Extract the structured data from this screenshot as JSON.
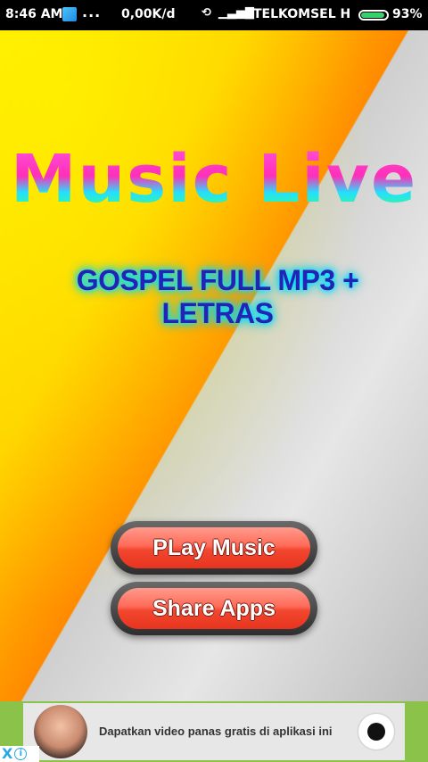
{
  "status_bar": {
    "time": "8:46 AM",
    "dots": "...",
    "speed": "0,00K/d",
    "carrier": "TELKOMSEL H",
    "battery_pct": "93%",
    "battery_level": 0.93
  },
  "main": {
    "title": "Music Live",
    "subtitle": "GOSPEL FULL MP3 + LETRAS",
    "buttons": [
      {
        "label": "PLay Music"
      },
      {
        "label": "Share Apps"
      }
    ]
  },
  "ad": {
    "text": "Dapatkan video panas gratis di aplikasi ini",
    "close_glyph": "X",
    "info_glyph": "i"
  },
  "colors": {
    "accent_green": "#8bc34a",
    "button_red": "#f2472f",
    "subtitle_blue": "#2323b5"
  }
}
